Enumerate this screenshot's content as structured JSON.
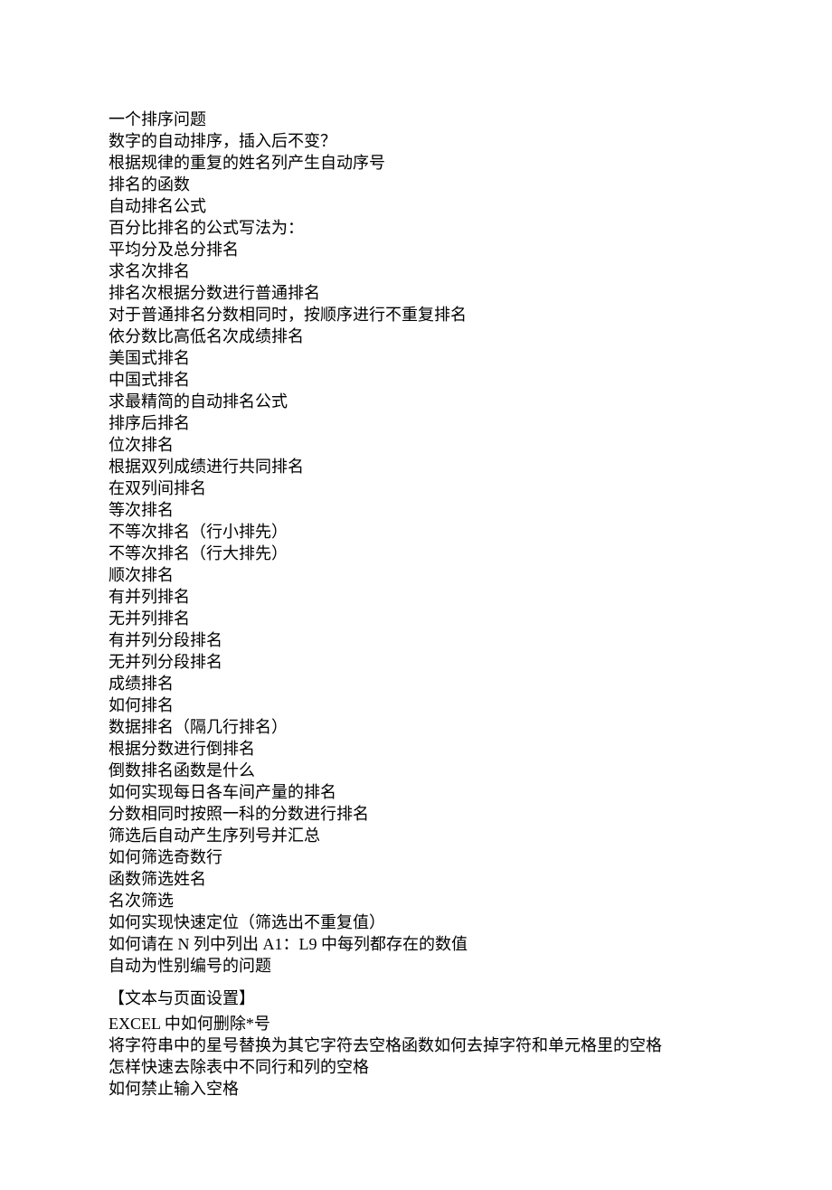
{
  "lines": [
    "一个排序问题",
    "数字的自动排序，插入后不变？",
    "根据规律的重复的姓名列产生自动序号",
    "排名的函数",
    "自动排名公式",
    "百分比排名的公式写法为：",
    "平均分及总分排名",
    "求名次排名",
    "排名次根据分数进行普通排名",
    "对于普通排名分数相同时，按顺序进行不重复排名",
    "依分数比高低名次成绩排名",
    "美国式排名",
    "中国式排名",
    "求最精简的自动排名公式",
    "排序后排名",
    "位次排名",
    "根据双列成绩进行共同排名",
    "在双列间排名",
    "等次排名",
    "不等次排名（行小排先）",
    "不等次排名（行大排先）",
    "顺次排名",
    "有并列排名",
    "无并列排名",
    "有并列分段排名",
    "无并列分段排名",
    "成绩排名",
    "如何排名",
    "数据排名（隔几行排名）",
    "根据分数进行倒排名",
    "倒数排名函数是什么",
    "如何实现每日各车间产量的排名",
    "分数相同时按照一科的分数进行排名",
    "筛选后自动产生序列号并汇总",
    "如何筛选奇数行",
    "函数筛选姓名",
    "名次筛选",
    "如何实现快速定位（筛选出不重复值）",
    "如何请在 N 列中列出 A1：L9 中每列都存在的数值",
    "自动为性别编号的问题"
  ],
  "section_heading": "【文本与页面设置】",
  "section_lines": [
    "EXCEL 中如何删除*号",
    "将字符串中的星号替换为其它字符去空格函数如何去掉字符和单元格里的空格",
    "怎样快速去除表中不同行和列的空格",
    "如何禁止输入空格"
  ]
}
